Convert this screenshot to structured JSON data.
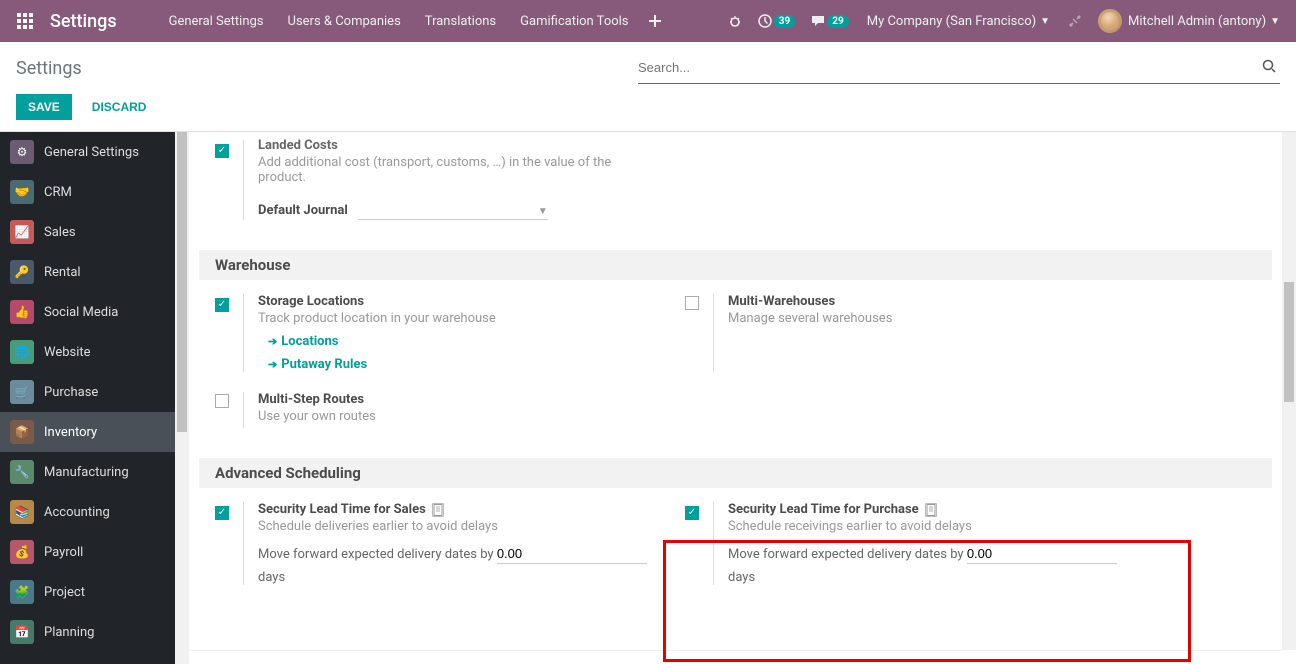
{
  "navbar": {
    "brand": "Settings",
    "menu": [
      "General Settings",
      "Users & Companies",
      "Translations",
      "Gamification Tools"
    ],
    "badge1": "39",
    "badge2": "29",
    "company": "My Company (San Francisco)",
    "user": "Mitchell Admin (antony)"
  },
  "cp": {
    "breadcrumb": "Settings",
    "search_placeholder": "Search...",
    "save": "SAVE",
    "discard": "DISCARD"
  },
  "sidebar": {
    "items": [
      {
        "label": "General Settings",
        "color": "#6b5b73"
      },
      {
        "label": "CRM",
        "color": "#4a6b73"
      },
      {
        "label": "Sales",
        "color": "#c55a5a"
      },
      {
        "label": "Rental",
        "color": "#4a5a6b"
      },
      {
        "label": "Social Media",
        "color": "#b54a6b"
      },
      {
        "label": "Website",
        "color": "#4a9b7a"
      },
      {
        "label": "Purchase",
        "color": "#6b8a9a"
      },
      {
        "label": "Inventory",
        "color": "#7a5a4a"
      },
      {
        "label": "Manufacturing",
        "color": "#5a8a6b"
      },
      {
        "label": "Accounting",
        "color": "#b5894a"
      },
      {
        "label": "Payroll",
        "color": "#b5586b"
      },
      {
        "label": "Project",
        "color": "#4a7a8a"
      },
      {
        "label": "Planning",
        "color": "#487a6a"
      }
    ],
    "active_index": 7
  },
  "content": {
    "landed": {
      "title": "Landed Costs",
      "desc": "Add additional cost (transport, customs, …) in the value of the product.",
      "journal_label": "Default Journal"
    },
    "sec_warehouse": "Warehouse",
    "storage": {
      "title": "Storage Locations",
      "desc": "Track product location in your warehouse",
      "link1": "Locations",
      "link2": "Putaway Rules"
    },
    "multiwh": {
      "title": "Multi-Warehouses",
      "desc": "Manage several warehouses"
    },
    "msr": {
      "title": "Multi-Step Routes",
      "desc": "Use your own routes"
    },
    "sec_adv": "Advanced Scheduling",
    "slt_sales": {
      "title": "Security Lead Time for Sales",
      "desc": "Schedule deliveries earlier to avoid delays",
      "field_label_pre": "Move forward expected delivery dates by ",
      "value": "0.00",
      "unit": "days"
    },
    "slt_purchase": {
      "title": "Security Lead Time for Purchase",
      "desc": "Schedule receivings earlier to avoid delays",
      "field_label_pre": "Move forward expected delivery dates by ",
      "value": "0.00",
      "unit": "days"
    }
  }
}
